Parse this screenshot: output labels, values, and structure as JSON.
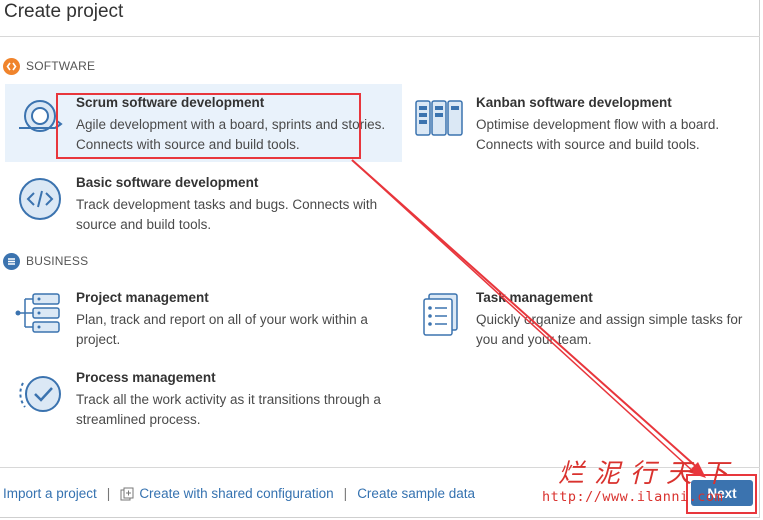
{
  "header": {
    "title": "Create project"
  },
  "sections": {
    "software": {
      "label": "SOFTWARE",
      "icon": "code-brackets-icon",
      "color": "#f0842c"
    },
    "business": {
      "label": "BUSINESS",
      "icon": "list-icon",
      "color": "#3b73af"
    }
  },
  "templates": {
    "scrum": {
      "name": "Scrum software development",
      "desc": "Agile development with a board, sprints and stories. Connects with source and build tools.",
      "icon": "scrum-cycle-icon",
      "selected": true
    },
    "kanban": {
      "name": "Kanban software development",
      "desc": "Optimise development flow with a board. Connects with source and build tools.",
      "icon": "kanban-board-icon"
    },
    "basic": {
      "name": "Basic software development",
      "desc": "Track development tasks and bugs. Connects with source and build tools.",
      "icon": "code-icon"
    },
    "project_mgmt": {
      "name": "Project management",
      "desc": "Plan, track and report on all of your work within a project.",
      "icon": "project-stack-icon"
    },
    "task_mgmt": {
      "name": "Task management",
      "desc": "Quickly organize and assign simple tasks for you and your team.",
      "icon": "task-list-icon"
    },
    "process_mgmt": {
      "name": "Process management",
      "desc": "Track all the work activity as it transitions through a streamlined process.",
      "icon": "check-circle-icon"
    }
  },
  "footer": {
    "import_label": "Import a project",
    "shared_label": "Create with shared configuration",
    "sample_label": "Create sample data",
    "separator": "|",
    "next_label": "Next"
  },
  "watermark": {
    "chinese": "烂泥行天下",
    "url": "http://www.ilanni.com"
  },
  "colors": {
    "link": "#3572b0",
    "selected_bg": "#e9f2fb",
    "annotation_red": "#e8363c",
    "primary_button": "#3b73af"
  }
}
